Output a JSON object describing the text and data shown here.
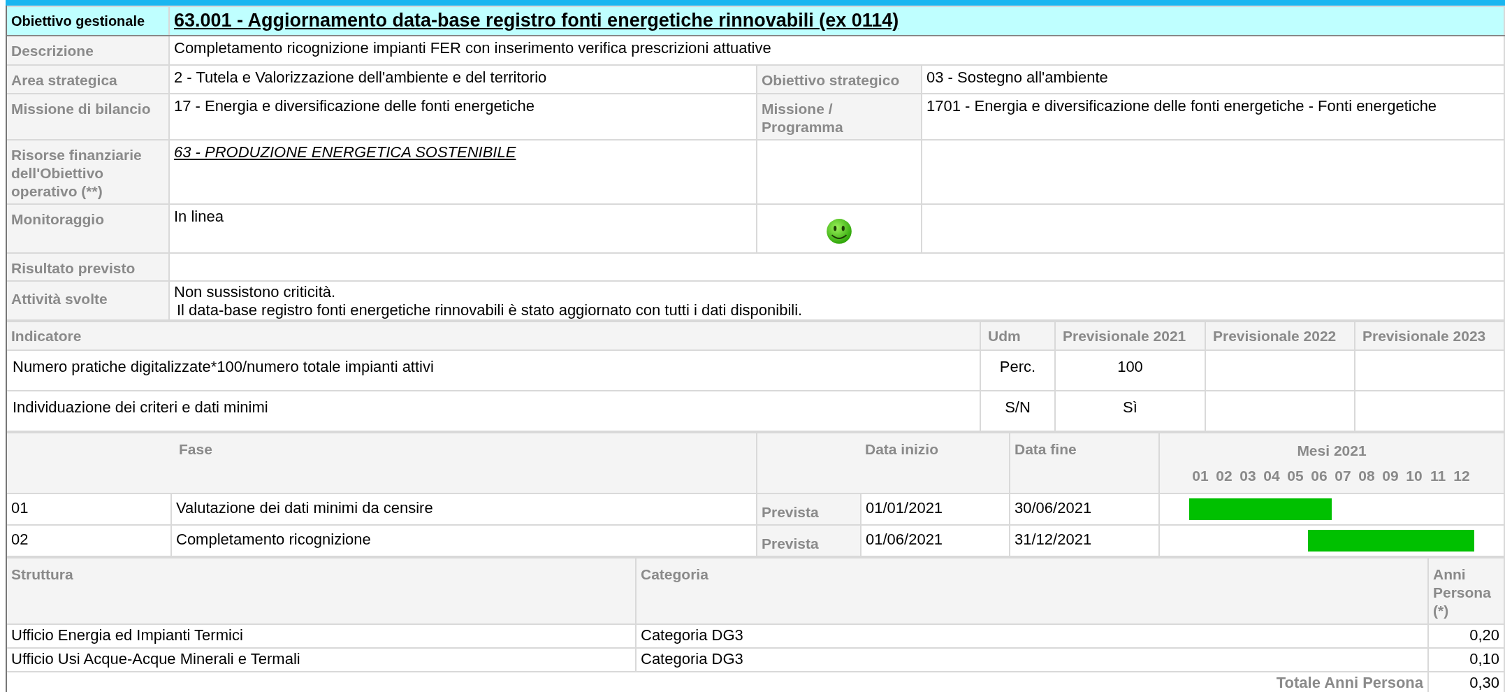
{
  "header": {
    "label": "Obiettivo gestionale",
    "title": "63.001 - Aggiornamento data-base registro fonti energetiche rinnovabili (ex 0114)"
  },
  "details": [
    {
      "kind": "wide",
      "label": "Descrizione",
      "value": "Completamento ricognizione impianti FER con inserimento verifica prescrizioni attuative"
    },
    {
      "kind": "pair",
      "label": "Area strategica",
      "value": "2 - Tutela e Valorizzazione dell'ambiente e del territorio",
      "label_2": "Obiettivo strategico",
      "value_2": "03 - Sostegno all'ambiente"
    },
    {
      "kind": "pair",
      "label": "Missione di bilancio",
      "value": "17 - Energia e diversificazione delle fonti energetiche",
      "label_2": "Missione / Programma",
      "value_2": "1701 - Energia e diversificazione delle fonti energetiche - Fonti energetiche"
    },
    {
      "kind": "link",
      "label": "Risorse finanziarie dell'Obiettivo operativo (**)",
      "value": "63 - PRODUZIONE ENERGETICA SOSTENIBILE"
    },
    {
      "kind": "status",
      "label": "Monitoraggio",
      "value": "In linea",
      "on_track": true
    },
    {
      "kind": "wide",
      "label": "Risultato previsto"
    },
    {
      "kind": "lines",
      "label": "Attività svolte",
      "lines": [
        "Non sussistono criticità.",
        "Il data-base registro fonti energetiche rinnovabili è stato aggiornato con tutti i dati disponibili."
      ]
    }
  ],
  "indicators": {
    "columns": [
      "Indicatore",
      "Udm",
      "Previsionale 2021",
      "Previsionale 2022",
      "Previsionale 2023"
    ],
    "rows": [
      {
        "cells": [
          "Numero pratiche digitalizzate*100/numero totale impianti attivi",
          "Perc.",
          "100"
        ]
      },
      {
        "cells": [
          "Individuazione dei criteri e dati minimi",
          "S/N",
          "Sì"
        ]
      }
    ]
  },
  "phases": {
    "columns": {
      "fase": "Fase",
      "data_inizio": "Data inizio",
      "data_fine": "Data fine",
      "mesi": "Mesi 2021"
    },
    "months": [
      "01",
      "02",
      "03",
      "04",
      "05",
      "06",
      "07",
      "08",
      "09",
      "10",
      "11",
      "12"
    ],
    "rows": [
      {
        "code": "01",
        "name": "Valutazione dei dati minimi da censire",
        "type": "Prevista",
        "start": "01/01/2021",
        "end": "30/06/2021",
        "active": [
          true,
          true,
          true,
          true,
          true,
          true,
          false,
          false,
          false,
          false,
          false,
          false
        ]
      },
      {
        "code": "02",
        "name": "Completamento  ricognizione",
        "type": "Prevista",
        "start": "01/06/2021",
        "end": "31/12/2021",
        "active": [
          false,
          false,
          false,
          false,
          false,
          true,
          true,
          true,
          true,
          true,
          true,
          true
        ]
      }
    ]
  },
  "staff": {
    "columns": [
      "Struttura",
      "Categoria",
      "Anni Persona (*)"
    ],
    "rows": [
      {
        "cells": [
          "Ufficio Energia ed Impianti Termici",
          "Categoria DG3",
          "0,20"
        ]
      },
      {
        "cells": [
          "Ufficio Usi Acque-Acque Minerali e Termali",
          "Categoria DG3",
          "0,10"
        ]
      }
    ],
    "total": {
      "label": "Totale Anni Persona",
      "value": "0,30"
    }
  }
}
